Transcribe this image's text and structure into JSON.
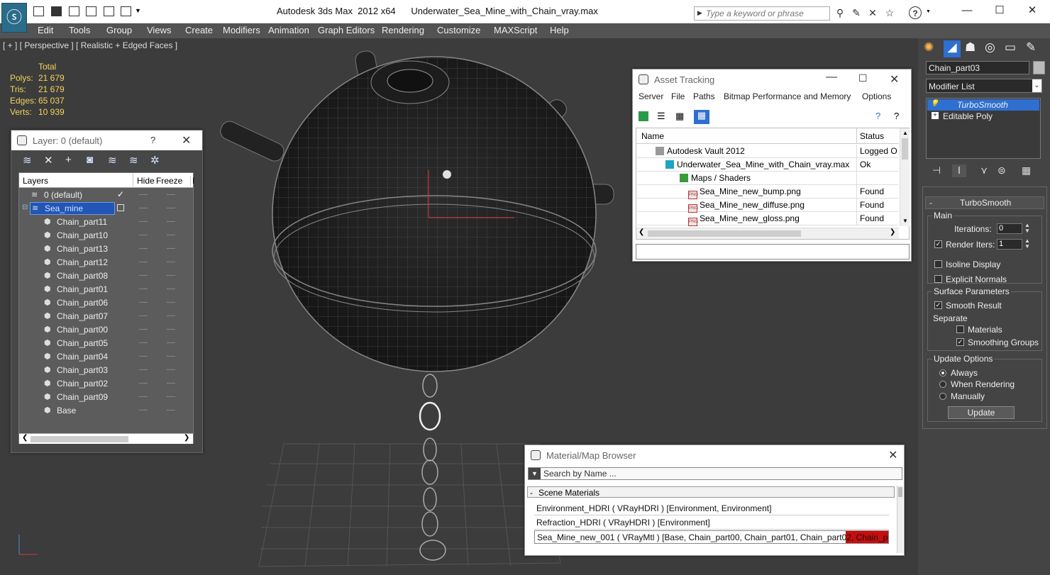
{
  "titlebar": {
    "title": "Autodesk 3ds Max  2012 x64      Underwater_Sea_Mine_with_Chain_vray.max",
    "search_placeholder": "Type a keyword or phrase",
    "help_label": "?"
  },
  "menu": {
    "items": [
      "Edit",
      "Tools",
      "Group",
      "Views",
      "Create",
      "Modifiers",
      "Animation",
      "Graph Editors",
      "Rendering",
      "Customize",
      "MAXScript",
      "Help"
    ]
  },
  "viewport": {
    "label": "[ + ] [ Perspective ] [ Realistic + Edged Faces ]",
    "stats": {
      "header": "Total",
      "rows": [
        [
          "Polys:",
          "21 679"
        ],
        [
          "Tris:",
          "21 679"
        ],
        [
          "Edges:",
          "65 037"
        ],
        [
          "Verts:",
          "10 939"
        ]
      ]
    }
  },
  "layer_dialog": {
    "title": "Layer: 0 (default)",
    "help": "?",
    "columns": [
      "Layers",
      "Hide",
      "Freeze",
      "I"
    ],
    "rows": [
      "0 (default)",
      "Sea_mine",
      "Chain_part11",
      "Chain_part10",
      "Chain_part13",
      "Chain_part12",
      "Chain_part08",
      "Chain_part01",
      "Chain_part06",
      "Chain_part07",
      "Chain_part00",
      "Chain_part05",
      "Chain_part04",
      "Chain_part03",
      "Chain_part02",
      "Chain_part09",
      "Base"
    ],
    "hide_mark": "----",
    "freeze_mark": "----"
  },
  "asset_tracking": {
    "title": "Asset Tracking",
    "menu": [
      "Server",
      "File",
      "Paths",
      "Bitmap Performance and Memory",
      "Options"
    ],
    "columns": [
      "Name",
      "Status"
    ],
    "rows": [
      {
        "name": "Autodesk Vault 2012",
        "status": "Logged O"
      },
      {
        "name": "Underwater_Sea_Mine_with_Chain_vray.max",
        "status": "Ok"
      },
      {
        "name": "Maps / Shaders",
        "status": ""
      },
      {
        "name": "Sea_Mine_new_bump.png",
        "status": "Found"
      },
      {
        "name": "Sea_Mine_new_diffuse.png",
        "status": "Found"
      },
      {
        "name": "Sea_Mine_new_gloss.png",
        "status": "Found"
      }
    ],
    "png_tag": "PNG"
  },
  "material_browser": {
    "title": "Material/Map Browser",
    "search_placeholder": "Search by Name ...",
    "section_toggle": "-",
    "section": "Scene Materials",
    "rows": [
      "Environment_HDRI  ( VRayHDRI )  [Environment, Environment]",
      "Refraction_HDRI  ( VRayHDRI )  [Environment]",
      "Sea_Mine_new_001  ( VRayMtl )  [Base, Chain_part00, Chain_part01, Chain_part02, Chain_part..."
    ]
  },
  "command_panel": {
    "object_name": "Chain_part03",
    "modifier_list": "Modifier List",
    "stack": [
      "TurboSmooth",
      "Editable Poly"
    ],
    "stack_expand": "+",
    "rollout_toggle": "-",
    "rollout_title": "TurboSmooth",
    "main_group": "Main",
    "iterations_label": "Iterations:",
    "iterations_value": "0",
    "render_iters_label": "Render Iters:",
    "render_iters_value": "1",
    "isoline": "Isoline Display",
    "explicit_normals": "Explicit Normals",
    "surface_group": "Surface Parameters",
    "smooth_result": "Smooth Result",
    "separate": "Separate",
    "materials": "Materials",
    "smoothing_groups": "Smoothing Groups",
    "update_group": "Update Options",
    "always": "Always",
    "when_rendering": "When Rendering",
    "manually": "Manually",
    "update_button": "Update"
  },
  "colors": {
    "accent": "#2f6fcf",
    "selected_row": "#2255b5",
    "stats": "#f2d45b",
    "selected_material": "#c80d0d"
  }
}
